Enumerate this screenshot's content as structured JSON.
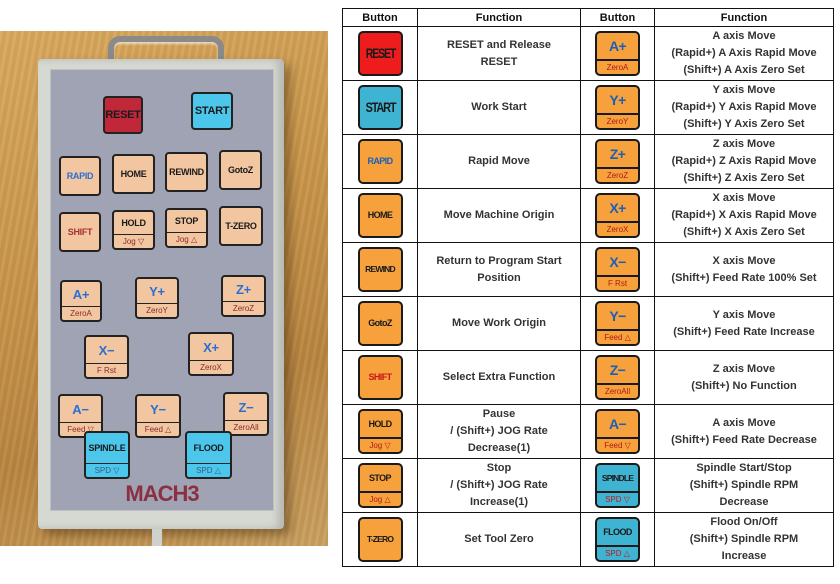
{
  "photo": {
    "brand_label": "MACH3",
    "keys": {
      "reset": "RESET",
      "start": "START",
      "rapid": "RAPID",
      "home": "HOME",
      "rewind": "REWIND",
      "gotoz": "GotoZ",
      "shift": "SHIFT",
      "hold": {
        "main": "HOLD",
        "sub": "Jog ▽"
      },
      "stop": {
        "main": "STOP",
        "sub": "Jog △"
      },
      "tzero": "T-ZERO",
      "a_plus": {
        "main": "A+",
        "sub": "ZeroA"
      },
      "y_plus": {
        "main": "Y+",
        "sub": "ZeroY"
      },
      "z_plus": {
        "main": "Z+",
        "sub": "ZeroZ"
      },
      "x_minus": {
        "main": "X−",
        "sub": "F Rst"
      },
      "x_plus": {
        "main": "X+",
        "sub": "ZeroX"
      },
      "a_minus": {
        "main": "A−",
        "sub": "Feed ▽"
      },
      "y_minus": {
        "main": "Y−",
        "sub": "Feed △"
      },
      "z_minus": {
        "main": "Z−",
        "sub": "ZeroAll"
      },
      "spindle": {
        "main": "SPINDLE",
        "sub": "SPD ▽"
      },
      "flood": {
        "main": "FLOOD",
        "sub": "SPD △"
      }
    }
  },
  "table": {
    "headers": [
      "Button",
      "Function",
      "Button",
      "Function"
    ],
    "rows": [
      {
        "left_button": {
          "main": "RESET",
          "sub": null,
          "color": "#ee1c1c"
        },
        "left_function": [
          "RESET and Release",
          "RESET"
        ],
        "right_button": {
          "main": "A+",
          "sub": "ZeroA",
          "color": "#f7a13c"
        },
        "right_function": [
          "A axis Move",
          "(Rapid+) A Axis Rapid Move",
          "(Shift+) A Axis Zero Set"
        ]
      },
      {
        "left_button": {
          "main": "START",
          "sub": null,
          "color": "#3fb4d2"
        },
        "left_function": [
          "Work Start"
        ],
        "right_button": {
          "main": "Y+",
          "sub": "ZeroY",
          "color": "#f7a13c"
        },
        "right_function": [
          "Y axis Move",
          "(Rapid+) Y Axis Rapid Move",
          "(Shift+) Y Axis Zero Set"
        ]
      },
      {
        "left_button": {
          "main": "RAPID",
          "sub": null,
          "color": "#f7a13c"
        },
        "left_function": [
          "Rapid Move"
        ],
        "right_button": {
          "main": "Z+",
          "sub": "ZeroZ",
          "color": "#f7a13c"
        },
        "right_function": [
          "Z axis Move",
          "(Rapid+) Z Axis Rapid Move",
          "(Shift+) Z Axis Zero Set"
        ]
      },
      {
        "left_button": {
          "main": "HOME",
          "sub": null,
          "color": "#f7a13c"
        },
        "left_function": [
          "Move Machine Origin"
        ],
        "right_button": {
          "main": "X+",
          "sub": "ZeroX",
          "color": "#f7a13c"
        },
        "right_function": [
          "X axis Move",
          "(Rapid+) X Axis Rapid Move",
          "(Shift+) X Axis Zero Set"
        ]
      },
      {
        "left_button": {
          "main": "REWIND",
          "sub": null,
          "color": "#f7a13c"
        },
        "left_function": [
          "Return to Program Start",
          "Position"
        ],
        "right_button": {
          "main": "X−",
          "sub": "F Rst",
          "color": "#f7a13c"
        },
        "right_function": [
          "X axis Move",
          "(Shift+) Feed Rate 100%  Set"
        ]
      },
      {
        "left_button": {
          "main": "GotoZ",
          "sub": null,
          "color": "#f7a13c"
        },
        "left_function": [
          "Move Work Origin"
        ],
        "right_button": {
          "main": "Y−",
          "sub": "Feed △",
          "color": "#f7a13c"
        },
        "right_function": [
          "Y axis Move",
          "(Shift+) Feed Rate Increase"
        ]
      },
      {
        "left_button": {
          "main": "SHIFT",
          "sub": null,
          "color": "#f7a13c"
        },
        "left_function": [
          "Select Extra Function"
        ],
        "right_button": {
          "main": "Z−",
          "sub": "ZeroAll",
          "color": "#f7a13c"
        },
        "right_function": [
          "Z axis Move",
          "(Shift+) No Function"
        ]
      },
      {
        "left_button": {
          "main": "HOLD",
          "sub": "Jog ▽",
          "color": "#f7a13c"
        },
        "left_function": [
          "Pause",
          "/ (Shift+) JOG Rate",
          "Decrease(1)"
        ],
        "right_button": {
          "main": "A−",
          "sub": "Feed ▽",
          "color": "#f7a13c"
        },
        "right_function": [
          "A axis Move",
          "(Shift+) Feed Rate Decrease"
        ]
      },
      {
        "left_button": {
          "main": "STOP",
          "sub": "Jog △",
          "color": "#f7a13c"
        },
        "left_function": [
          "Stop",
          "/ (Shift+) JOG Rate",
          "Increase(1)"
        ],
        "right_button": {
          "main": "SPINDLE",
          "sub": "SPD ▽",
          "color": "#3fb4d2"
        },
        "right_function": [
          "Spindle Start/Stop",
          "(Shift+) Spindle RPM",
          "Decrease"
        ]
      },
      {
        "left_button": {
          "main": "T-ZERO",
          "sub": null,
          "color": "#f7a13c"
        },
        "left_function": [
          "Set Tool Zero"
        ],
        "right_button": {
          "main": "FLOOD",
          "sub": "SPD △",
          "color": "#3fb4d2"
        },
        "right_function": [
          "Flood On/Off",
          "(Shift+) Spindle RPM",
          "Increase"
        ]
      }
    ]
  }
}
